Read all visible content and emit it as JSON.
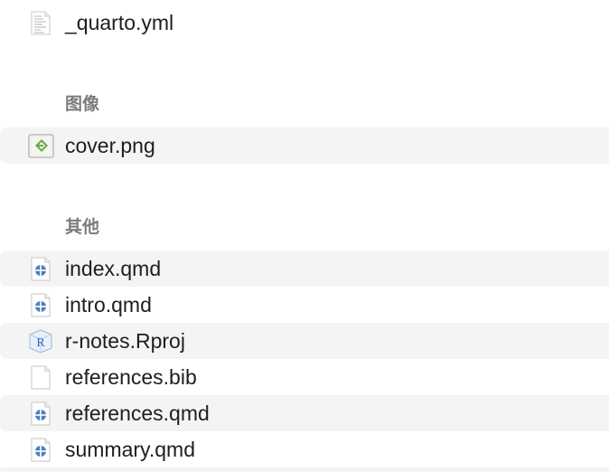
{
  "files_top": [
    {
      "label": "_quarto.yml",
      "icon": "yaml-document-icon"
    }
  ],
  "sections": [
    {
      "title": "图像",
      "items": [
        {
          "label": "cover.png",
          "icon": "image-file-icon"
        }
      ]
    },
    {
      "title": "其他",
      "items": [
        {
          "label": "index.qmd",
          "icon": "quarto-file-icon"
        },
        {
          "label": "intro.qmd",
          "icon": "quarto-file-icon"
        },
        {
          "label": "r-notes.Rproj",
          "icon": "r-project-icon"
        },
        {
          "label": "references.bib",
          "icon": "blank-document-icon"
        },
        {
          "label": "references.qmd",
          "icon": "quarto-file-icon"
        },
        {
          "label": "summary.qmd",
          "icon": "quarto-file-icon"
        }
      ]
    }
  ],
  "colors": {
    "row_alt_bg": "#f4f4f5",
    "section_title": "#7b7b7b",
    "quarto_blue": "#4b7fc2",
    "image_green": "#6aa84f",
    "r_blue": "#2d6fb8"
  }
}
